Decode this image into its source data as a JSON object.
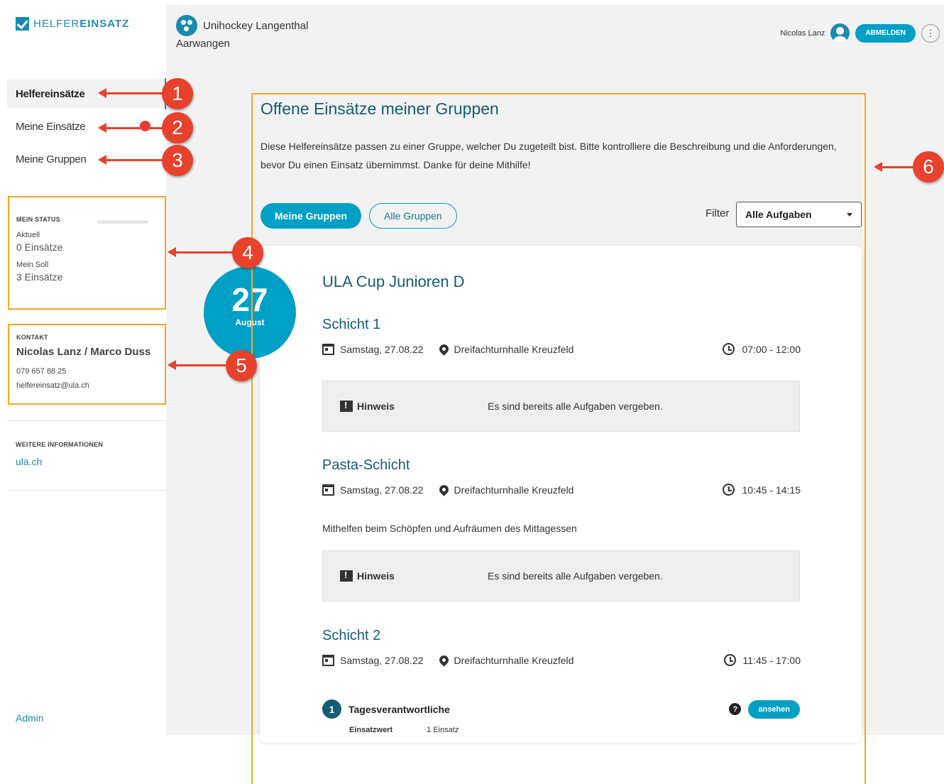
{
  "brand": {
    "prefix": "HELFER",
    "suffix": "EINSATZ"
  },
  "sidebar": {
    "nav": [
      {
        "label": "Helfereinsätze"
      },
      {
        "label": "Meine Einsätze"
      },
      {
        "label": "Meine Gruppen"
      }
    ],
    "status": {
      "heading": "MEIN STATUS",
      "current_label": "Aktuell",
      "current_value": "0 Einsätze",
      "target_label": "Mein Soll",
      "target_value": "3 Einsätze"
    },
    "contact": {
      "heading": "KONTAKT",
      "name": "Nicolas Lanz / Marco Duss",
      "phone": "079 657 88 25",
      "email": "helfereinsatz@ula.ch"
    },
    "more": {
      "heading": "WEITERE INFORMATIONEN",
      "link": "ula.ch"
    },
    "admin": "Admin"
  },
  "header": {
    "group_name": "Unihockey Langenthal",
    "location": "Aarwangen",
    "user_name": "Nicolas Lanz",
    "logout": "ABMELDEN",
    "more": "⋮"
  },
  "main": {
    "title": "Offene Einsätze meiner Gruppen",
    "description": "Diese Helfereinsätze passen zu einer Gruppe, welcher Du zugeteilt bist. Bitte kontrolliere die Beschreibung und die Anforderungen, bevor Du einen Einsatz übernimmst. Danke für deine Mithilfe!",
    "tab_mine": "Meine Gruppen",
    "tab_all": "Alle Gruppen",
    "filter_label": "Filter",
    "filter_value": "Alle Aufgaben"
  },
  "event": {
    "day": "27",
    "month": "August",
    "title": "ULA Cup Junioren D",
    "shifts": [
      {
        "title": "Schicht 1",
        "date": "Samstag, 27.08.22",
        "place": "Dreifachturnhalle Kreuzfeld",
        "time": "07:00 - 12:00",
        "hint_label": "Hinweis",
        "hint_text": "Es sind bereits alle Aufgaben vergeben."
      },
      {
        "title": "Pasta-Schicht",
        "date": "Samstag, 27.08.22",
        "place": "Dreifachturnhalle Kreuzfeld",
        "time": "10:45 - 14:15",
        "description": "Mithelfen beim Schöpfen und Aufräumen des Mittagessen",
        "hint_label": "Hinweis",
        "hint_text": "Es sind bereits alle Aufgaben vergeben."
      },
      {
        "title": "Schicht 2",
        "date": "Samstag, 27.08.22",
        "place": "Dreifachturnhalle Kreuzfeld",
        "time": "11:45 - 17:00",
        "task": {
          "count": "1",
          "name": "Tagesverantwortliche",
          "help": "?",
          "action": "ansehen",
          "value_label": "Einsatzwert",
          "value": "1 Einsatz"
        }
      }
    ]
  },
  "annotations": [
    "1",
    "2",
    "3",
    "4",
    "5",
    "6"
  ],
  "colors": {
    "accent": "#00a0c6",
    "title": "#145c73",
    "highlight": "#f5a623",
    "callout": "#e8412c"
  }
}
